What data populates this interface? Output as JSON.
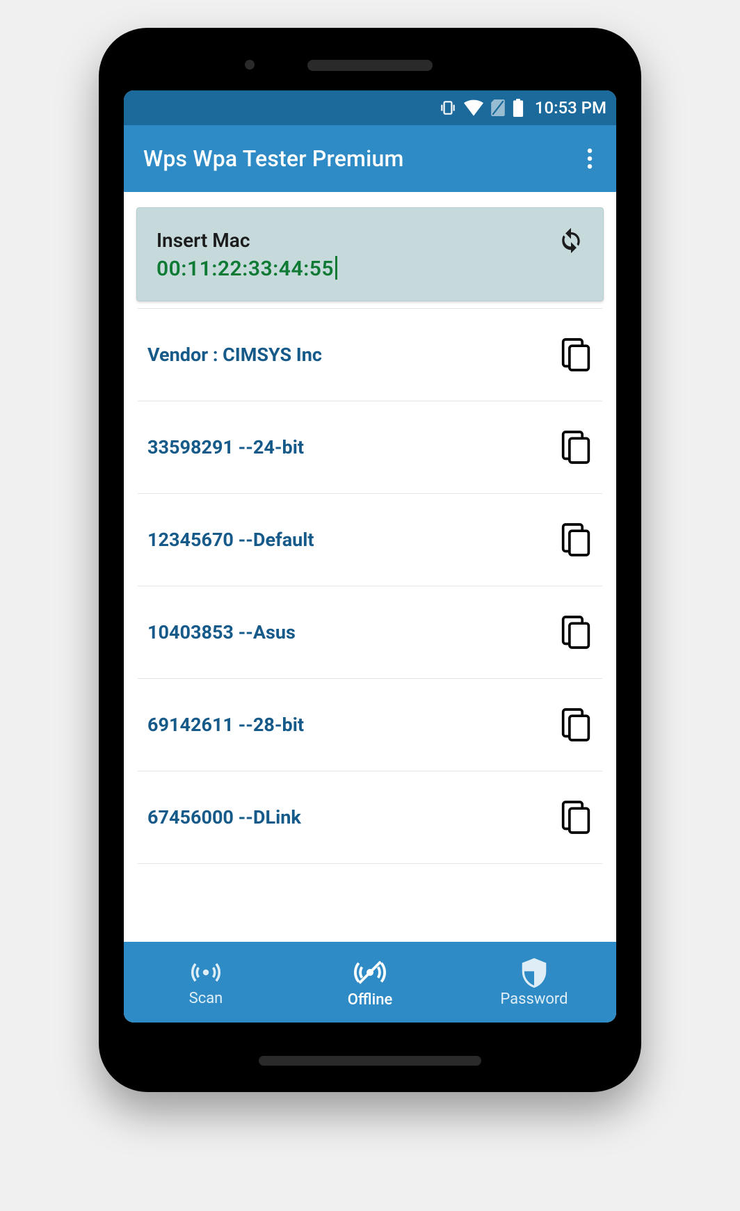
{
  "status": {
    "time": "10:53 PM"
  },
  "appbar": {
    "title": "Wps Wpa Tester Premium"
  },
  "card": {
    "label": "Insert Mac",
    "mac": "00:11:22:33:44:55"
  },
  "results": [
    {
      "text": "Vendor : CIMSYS Inc"
    },
    {
      "text": "33598291 --24-bit"
    },
    {
      "text": "12345670 --Default"
    },
    {
      "text": "10403853 --Asus"
    },
    {
      "text": "69142611 --28-bit"
    },
    {
      "text": "67456000 --DLink"
    }
  ],
  "nav": {
    "scan": "Scan",
    "offline": "Offline",
    "password": "Password"
  }
}
